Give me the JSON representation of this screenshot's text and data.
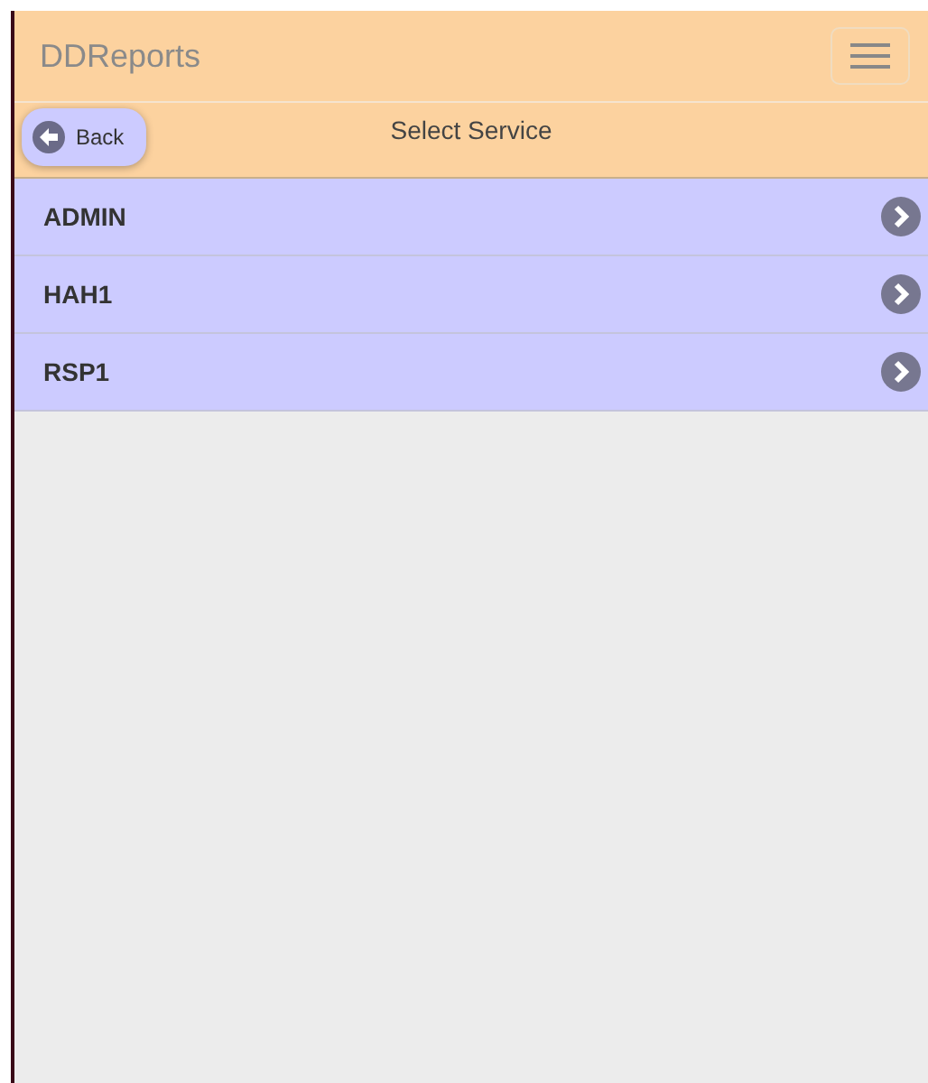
{
  "header": {
    "title": "DDReports"
  },
  "toolbar": {
    "back_button": "Back",
    "title": "Select Service"
  },
  "services": [
    {
      "label": "ADMIN"
    },
    {
      "label": "HAH1"
    },
    {
      "label": "RSP1"
    }
  ]
}
